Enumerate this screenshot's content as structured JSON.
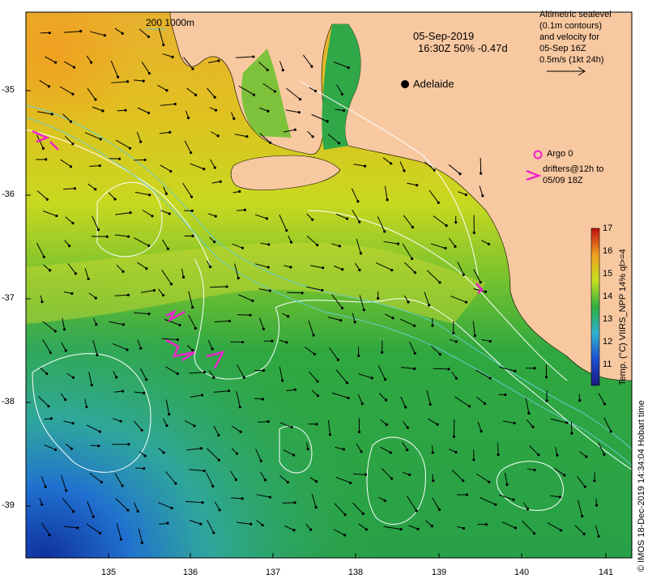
{
  "map": {
    "date_line1": "05-Sep-2019",
    "date_line2": "16:30Z  50% -0.47d",
    "scale_label": "200  1000m",
    "city": "Adelaide",
    "legend_lines": [
      "Altimetric sealevel",
      "(0.1m contours)",
      "and velocity for",
      "05-Sep 16Z",
      "0.5m/s (1kt 24h)"
    ],
    "argo_label": "Argo 0",
    "drifters_line1": "drifters@12h to",
    "drifters_line2": "05/09 18Z",
    "colorbar_title": "Temp. (°C) VIIRS_NPP 14% ql>=4",
    "colorbar_ticks": [
      "17",
      "16",
      "15",
      "14",
      "13",
      "12",
      "11"
    ],
    "credit_right": "© IMOS 18-Dec-2019 14:34:04 Hobart time",
    "y_ticks": [
      "-35",
      "-36",
      "-37",
      "-38",
      "-39"
    ],
    "x_ticks": [
      "135",
      "136",
      "137",
      "138",
      "139",
      "140",
      "141"
    ],
    "colors": {
      "land": "#f8c8a0",
      "drifter": "#ee22cc",
      "contour": "#ffffff",
      "isobath": "#66cccc"
    }
  }
}
